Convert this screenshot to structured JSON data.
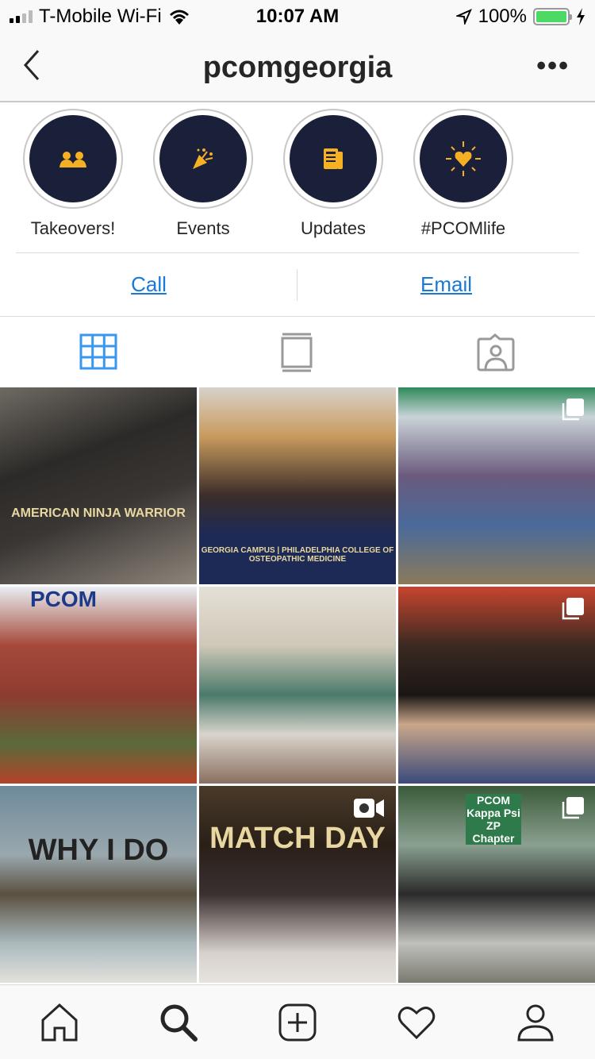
{
  "status_bar": {
    "carrier": "T-Mobile Wi-Fi",
    "time": "10:07 AM",
    "battery": "100%",
    "battery_level": 100,
    "battery_color": "#4cd964"
  },
  "header": {
    "title": "pcomgeorgia"
  },
  "highlights": [
    {
      "label": "Takeovers!",
      "icon": "two-people-icon"
    },
    {
      "label": "Events",
      "icon": "party-popper-icon"
    },
    {
      "label": "Updates",
      "icon": "newspaper-icon"
    },
    {
      "label": "#PCOMlife",
      "icon": "shining-heart-icon"
    }
  ],
  "highlight_colors": {
    "background": "#1b203a",
    "icon": "#f5b023"
  },
  "contact": {
    "call": "Call",
    "email": "Email",
    "link_color": "#1a79d6"
  },
  "profile_tabs": [
    {
      "name": "grid",
      "active": true
    },
    {
      "name": "feed",
      "active": false
    },
    {
      "name": "tagged",
      "active": false
    }
  ],
  "accent": "#3897f0",
  "posts": [
    {
      "caption": "AMERICAN NINJA WARRIOR",
      "multi": false,
      "video": false
    },
    {
      "caption": "GEORGIA CAMPUS | PHILADELPHIA COLLEGE OF OSTEOPATHIC MEDICINE",
      "multi": false,
      "video": false
    },
    {
      "caption": "",
      "multi": true,
      "video": false
    },
    {
      "caption": "PCOM",
      "multi": false,
      "video": false
    },
    {
      "caption": "",
      "multi": false,
      "video": false
    },
    {
      "caption": "",
      "multi": true,
      "video": false
    },
    {
      "caption": "WHY I DO",
      "multi": false,
      "video": false
    },
    {
      "caption": "MATCH DAY",
      "multi": false,
      "video": true
    },
    {
      "caption": "PCOM Kappa Psi ZP Chapter",
      "multi": true,
      "video": false
    }
  ],
  "bottom_nav": [
    {
      "name": "home"
    },
    {
      "name": "search",
      "active": true
    },
    {
      "name": "new-post"
    },
    {
      "name": "activity"
    },
    {
      "name": "profile"
    }
  ]
}
